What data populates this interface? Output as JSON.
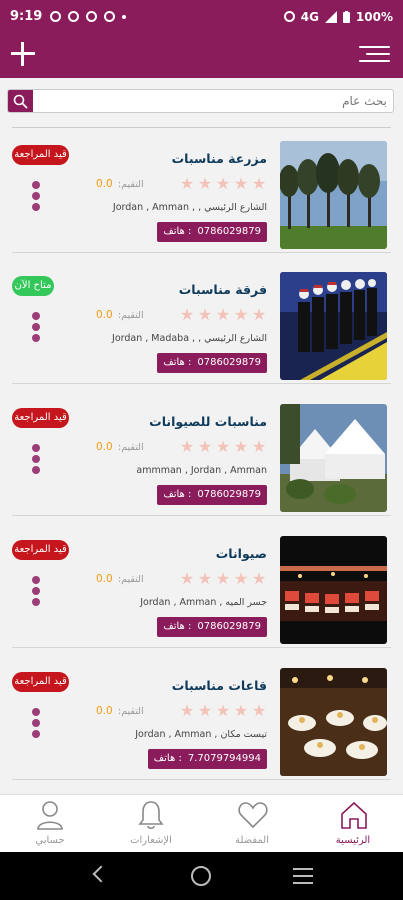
{
  "status_bar": {
    "time": "9:19",
    "network": "4G",
    "battery": "100%"
  },
  "search": {
    "placeholder": "بحث عام"
  },
  "listings": [
    {
      "name": "مزرعة مناسبات",
      "badge": "قيد المراجعة",
      "badge_color": "red",
      "rating_label": "التقيم:",
      "rating": "0.0",
      "address": "الشارع الرئيسي , , Jordan , Amman",
      "phone_label": "هاتف :",
      "phone": "0786029879",
      "image": "farm-trees"
    },
    {
      "name": "فرقة مناسبات",
      "badge": "متاح الآن",
      "badge_color": "green",
      "rating_label": "التقيم:",
      "rating": "0.0",
      "address": "الشارع الرئيسي , , Jordan , Madaba",
      "phone_label": "هاتف :",
      "phone": "0786029879",
      "image": "dance-troupe"
    },
    {
      "name": "مناسبات للصيوانات",
      "badge": "قيد المراجعة",
      "badge_color": "red",
      "rating_label": "التقيم:",
      "rating": "0.0",
      "address": "ammman , Jordan , Amman",
      "phone_label": "هاتف :",
      "phone": "0786029879",
      "image": "white-tents"
    },
    {
      "name": "صيوانات",
      "badge": "قيد المراجعة",
      "badge_color": "red",
      "rating_label": "التقيم:",
      "rating": "0.0",
      "address": "جسر الميه , Jordan , Amman",
      "phone_label": "هاتف :",
      "phone": "0786029879",
      "image": "tent-interior"
    },
    {
      "name": "قاعات مناسبات",
      "badge": "قيد المراجعة",
      "badge_color": "red",
      "rating_label": "التقيم:",
      "rating": "0.0",
      "address": "تيست مكان , Jordan , Amman",
      "phone_label": "هاتف :",
      "phone": "7.7079794994",
      "image": "banquet-hall"
    }
  ],
  "bottom_nav": [
    {
      "label": "حسابي",
      "icon": "user-icon"
    },
    {
      "label": "الإشعارات",
      "icon": "bell-icon"
    },
    {
      "label": "المفضلة",
      "icon": "heart-icon"
    },
    {
      "label": "الرئيسية",
      "icon": "home-icon",
      "active": true
    }
  ],
  "colors": {
    "primary": "#8a1c5c",
    "title": "#0e3a5b",
    "review_badge": "#c4161c",
    "available_badge": "#34c759",
    "rating": "#f39c12",
    "star": "#f3c2b8"
  }
}
